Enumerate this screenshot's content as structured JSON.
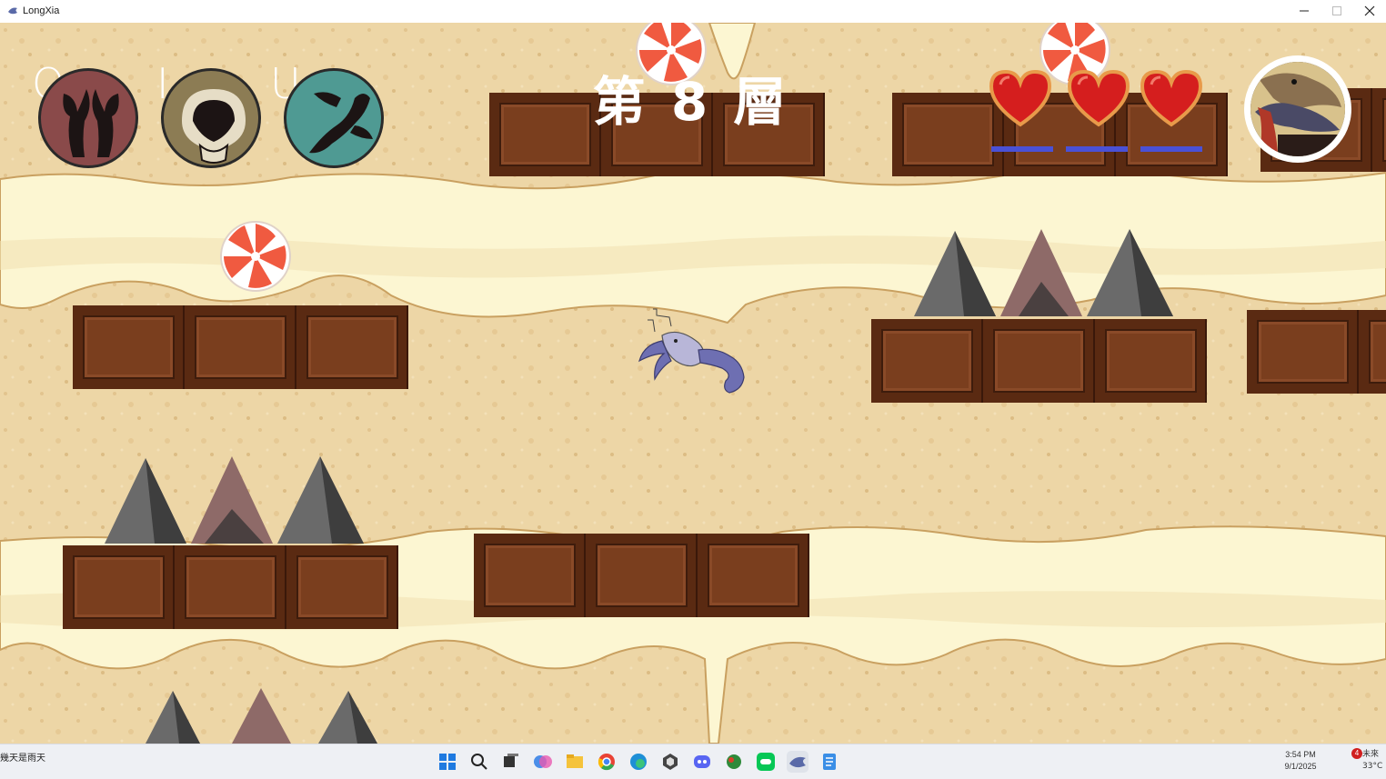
{
  "window": {
    "title": "LongXia"
  },
  "hud": {
    "layer_label": "第 8 層",
    "skills": [
      {
        "key": "O",
        "icon": "claws-icon",
        "color": "#8a4a4a"
      },
      {
        "key": "I",
        "icon": "shell-icon",
        "color": "#8c7c54"
      },
      {
        "key": "U",
        "icon": "scorpion-icon",
        "color": "#4f9a93"
      }
    ],
    "lives": 3,
    "hearts": [
      "heart-1",
      "heart-2",
      "heart-3"
    ],
    "portrait_icon": "crayfish-portrait-icon"
  },
  "colors": {
    "sand": "#edd6a6",
    "cream": "#fcf6d2",
    "chocolate": "#6b3418",
    "chocolate_light": "#8a4a28",
    "hp_bar": "#4a51d6",
    "candy_red": "#f05a40"
  },
  "taskbar": {
    "weather_left": "幾天是雨天",
    "clock_time": "3:54 PM",
    "clock_date": "9/1/2025",
    "weather_right_label": "未來",
    "weather_right_temp": "33°C",
    "notification_count": "4",
    "icons": [
      "start-icon",
      "search-icon",
      "taskview-icon",
      "copilot-icon",
      "file-explorer-icon",
      "chrome-icon",
      "edge-icon",
      "unity-icon",
      "discord-icon",
      "game-icon",
      "line-icon",
      "longxia-app-icon",
      "notepad-icon"
    ]
  }
}
